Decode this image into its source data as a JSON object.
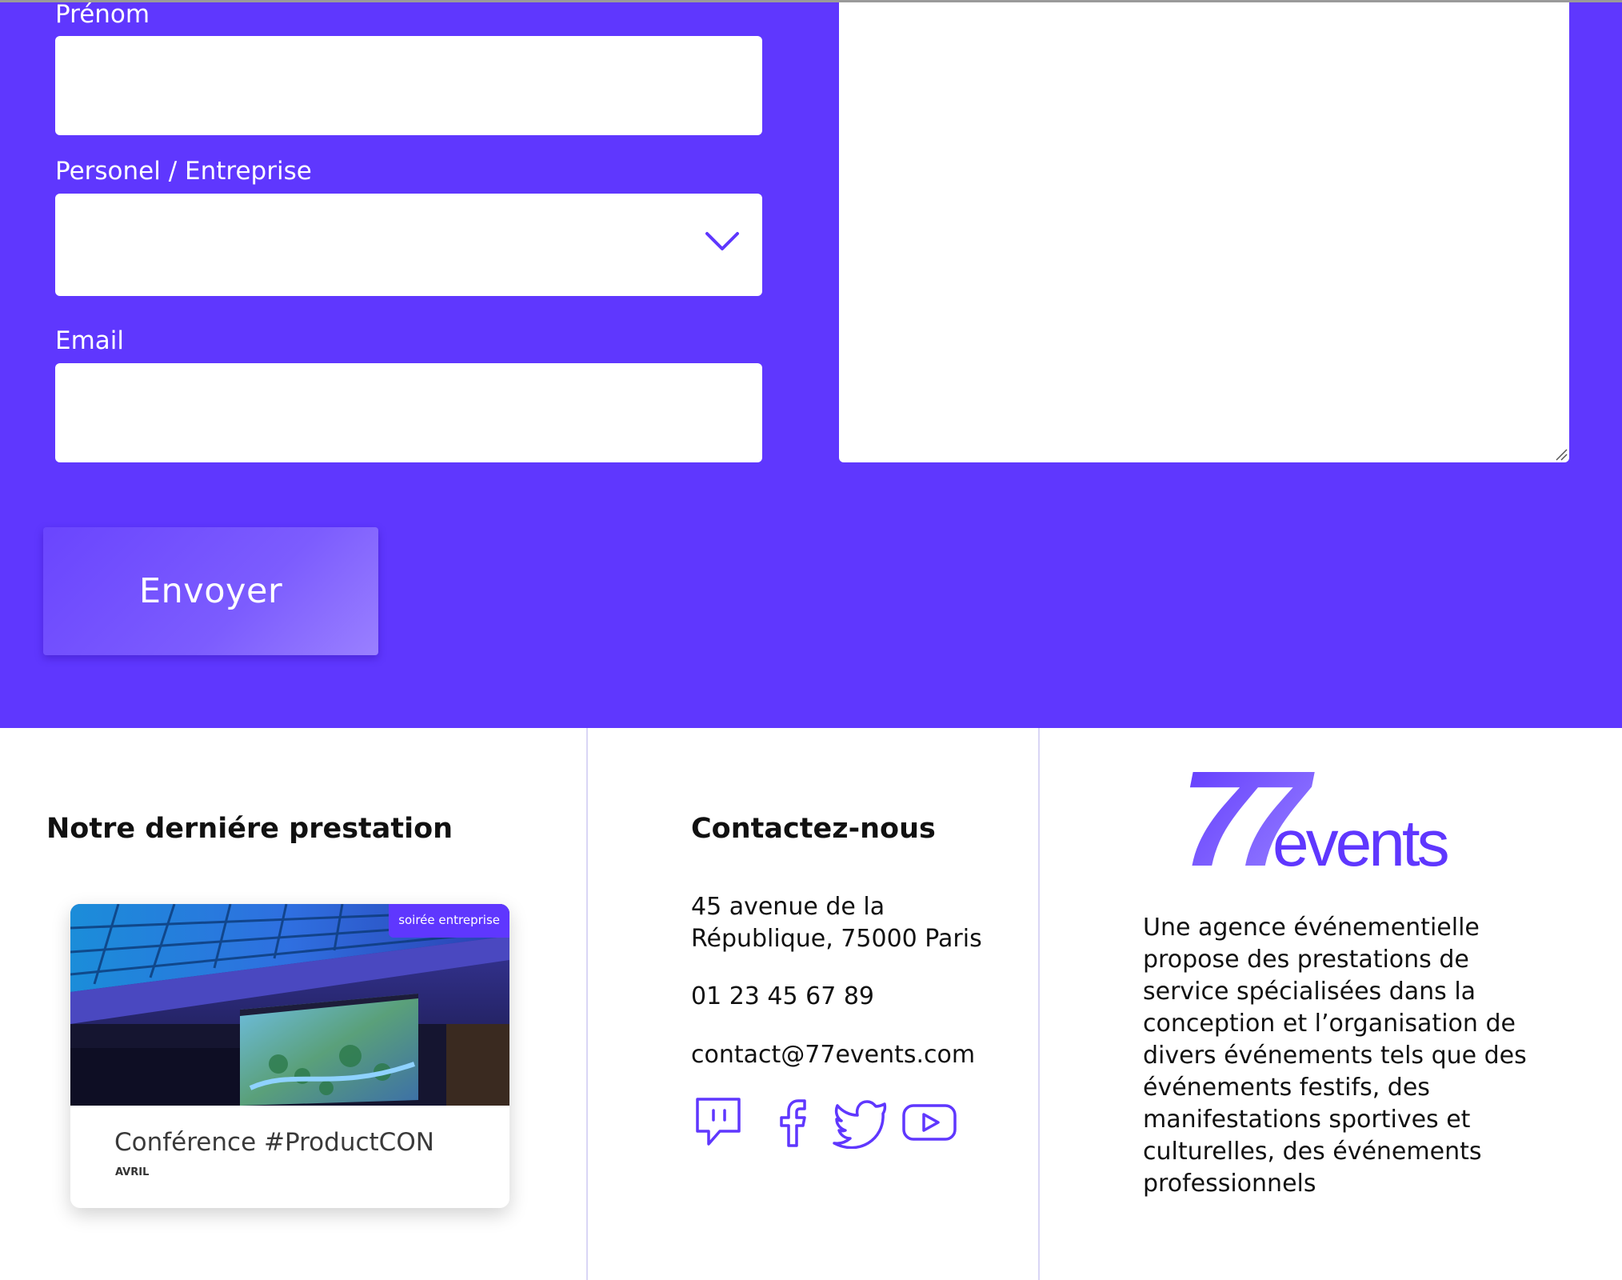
{
  "form": {
    "first_name_label": "Prénom",
    "account_type_label": "Personel / Entreprise",
    "email_label": "Email",
    "submit_label": "Envoyer"
  },
  "footer": {
    "latest": {
      "title": "Notre derniére prestation",
      "card_tag": "soirée entreprise",
      "card_title": "Conférence #ProductCON",
      "card_month": "AVRIL"
    },
    "contact": {
      "title": "Contactez-nous",
      "address_line1": "45 avenue de la",
      "address_line2": "République, 75000 Paris",
      "phone": "01 23 45 67 89",
      "email": "contact@77events.com",
      "social_icons": [
        "twitch-icon",
        "facebook-icon",
        "twitter-icon",
        "youtube-icon"
      ]
    },
    "brand": {
      "logo_number": "77",
      "logo_word": "events",
      "description": "Une agence événementielle propose des prestations de service spécialisées dans la conception et l’organisation de divers événements tels que des événements festifs, des manifestations sportives et culturelles, des événements professionnels"
    }
  },
  "colors": {
    "accent": "#5f37fe",
    "logo_gradient_start": "#5f37fe",
    "logo_gradient_end": "#9b86ff"
  }
}
